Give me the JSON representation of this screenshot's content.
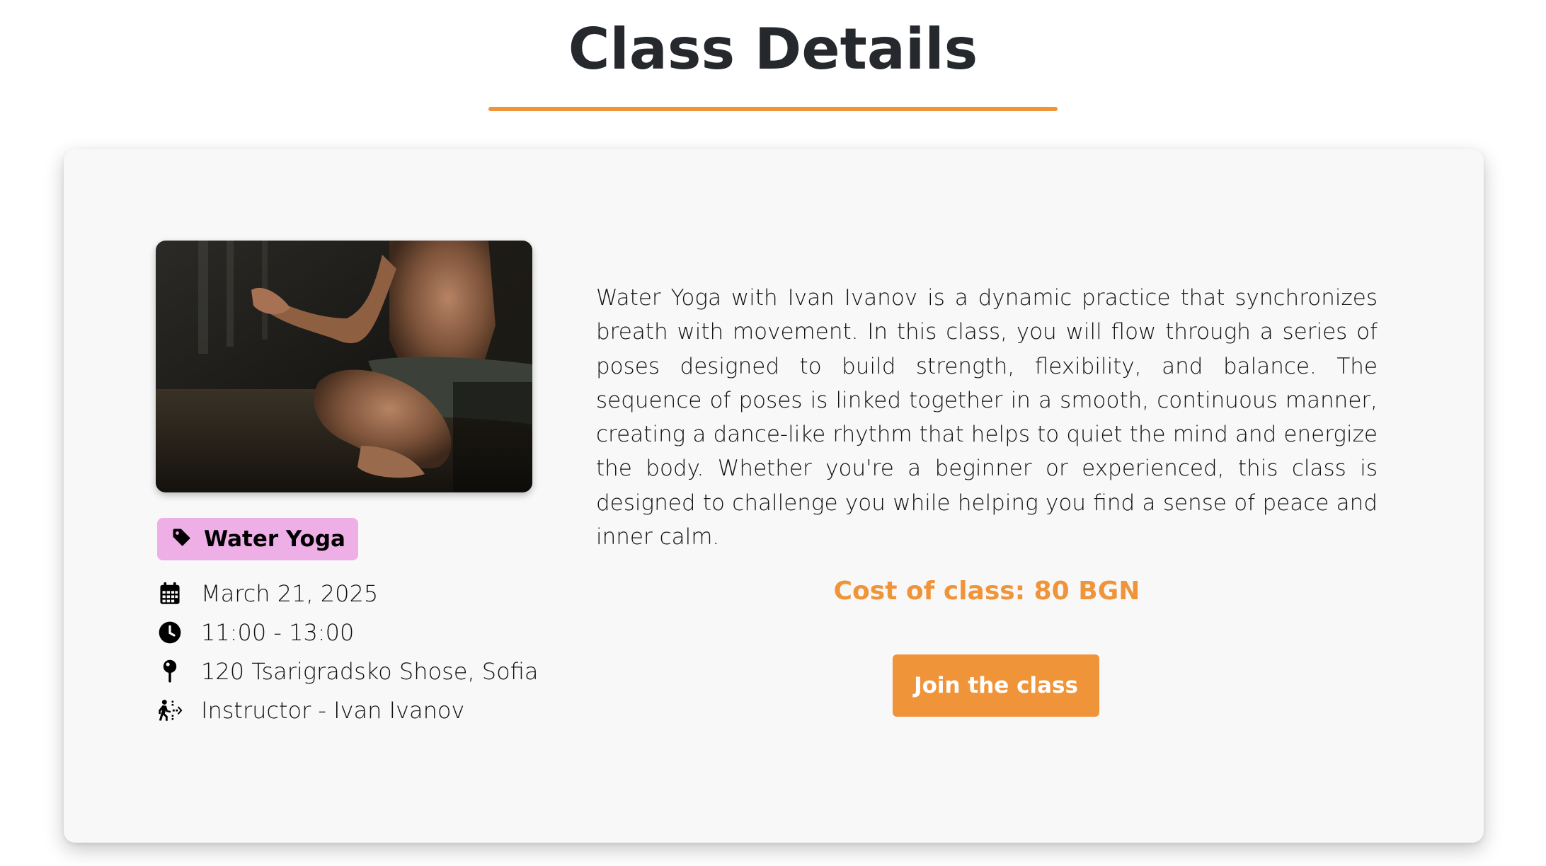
{
  "page": {
    "title": "Class Details"
  },
  "colors": {
    "accent": "#f0943a",
    "badge_bg": "#eeaee6",
    "card_bg": "#f8f8f8",
    "title": "#25282d",
    "button_text": "#ffffff"
  },
  "class": {
    "image_alt": "Person meditating in lotus pose",
    "category": "Water Yoga",
    "category_icon": "tag-icon",
    "details": [
      {
        "icon": "calendar-icon",
        "text": "March 21, 2025"
      },
      {
        "icon": "clock-icon",
        "text": "11:00 - 13:00"
      },
      {
        "icon": "map-pin-icon",
        "text": "120 Tsarigradsko Shose, Sofia"
      },
      {
        "icon": "instructor-icon",
        "text": "Instructor - Ivan Ivanov"
      }
    ],
    "description": "Water Yoga with Ivan Ivanov is a dynamic practice that synchronizes breath with movement. In this class, you will flow through a series of poses designed to build strength, flexibility, and balance. The sequence of poses is linked together in a smooth, continuous manner, creating a dance-like rhythm that helps to quiet the mind and energize the body. Whether you're a beginner or experienced, this class is designed to challenge you while helping you find a sense of peace and inner calm.",
    "cost": "Cost of class: 80 BGN",
    "join_label": "Join the class"
  }
}
